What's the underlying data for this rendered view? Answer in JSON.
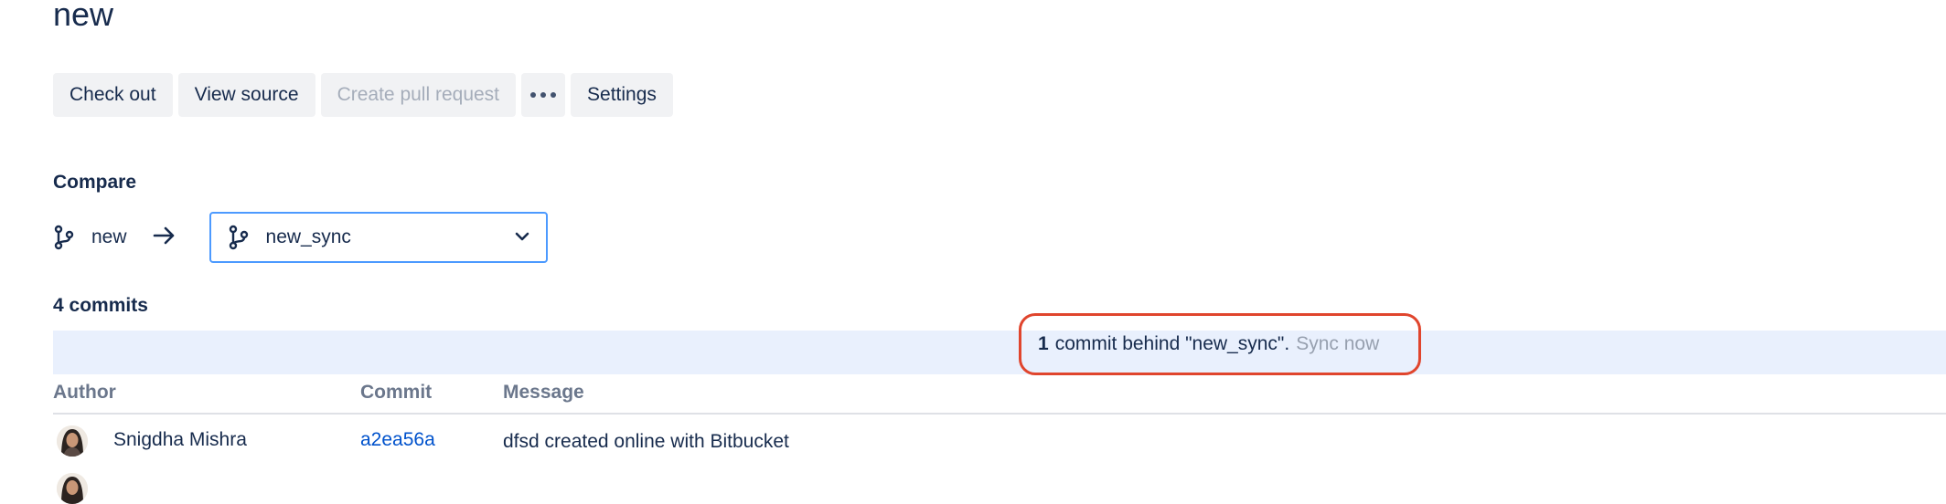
{
  "page": {
    "title": "new"
  },
  "toolbar": {
    "checkout_label": "Check out",
    "view_source_label": "View source",
    "create_pr_label": "Create pull request",
    "more_icon": "more-horizontal-icon",
    "settings_label": "Settings"
  },
  "compare": {
    "label": "Compare",
    "source_branch": "new",
    "target_branch": "new_sync",
    "branch_icon": "branch-icon",
    "arrow_icon": "arrow-right-icon",
    "dropdown_icon": "chevron-down-icon"
  },
  "commits": {
    "count_label": "4 commits",
    "sync_notice": {
      "count": "1",
      "text": "commit behind \"new_sync\".",
      "link": "Sync now"
    },
    "columns": {
      "author": "Author",
      "commit": "Commit",
      "message": "Message"
    },
    "rows": [
      {
        "author": "Snigdha Mishra",
        "hash": "a2ea56a",
        "message": "dfsd created online with Bitbucket"
      }
    ]
  },
  "colors": {
    "primary_text": "#172b4d",
    "link": "#0052cc",
    "focus_border": "#4c9aff",
    "sync_bar_bg": "#e9f0fd",
    "highlight_annotation": "#e0452d",
    "button_bg": "#f1f2f4",
    "disabled_text": "#a5adba"
  }
}
